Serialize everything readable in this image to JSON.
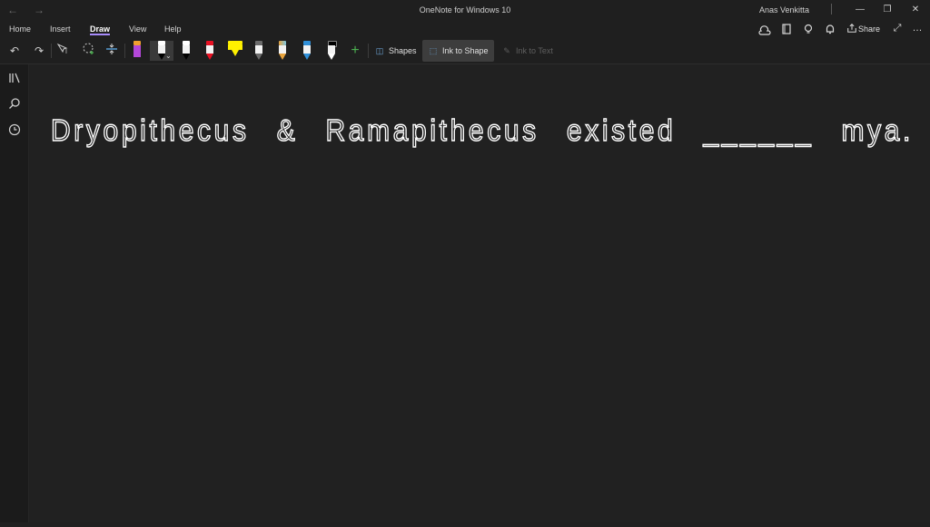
{
  "titlebar": {
    "back_glyph": "←",
    "forward_glyph": "→",
    "title": "OneNote for Windows 10",
    "user": "Anas Venkitta",
    "minimize_glyph": "—",
    "restore_glyph": "❐",
    "close_glyph": "✕"
  },
  "menu": {
    "tabs": [
      "Home",
      "Insert",
      "Draw",
      "View",
      "Help"
    ],
    "active_tab": "Draw",
    "right_icons": [
      "sync-icon",
      "notebook-icon",
      "lightbulb-icon",
      "bell-icon"
    ],
    "share_label": "Share",
    "expand_glyph": "⤢",
    "more_glyph": "…"
  },
  "toolbar": {
    "undo_glyph": "↶",
    "redo_glyph": "↷",
    "pens": [
      {
        "name": "purple-pen",
        "color": "#b347d9",
        "cap": "#f0a030"
      },
      {
        "name": "black-pen-selected",
        "color": "#000000",
        "cap": "#ffffff"
      },
      {
        "name": "black-pen",
        "color": "#000000",
        "cap": "#ffffff"
      },
      {
        "name": "red-pen",
        "color": "#e81123",
        "cap": "#e81123"
      },
      {
        "name": "yellow-highlighter",
        "color": "#fff100",
        "cap": "#fff100"
      },
      {
        "name": "galaxy-pen",
        "color": "#6b6b6b",
        "cap": "#6b6b6b"
      },
      {
        "name": "rainbow-pen",
        "color": "#e8a33c",
        "cap": "#7ec8e3"
      },
      {
        "name": "ocean-pen",
        "color": "#2f8fd8",
        "cap": "#2f8fd8"
      },
      {
        "name": "white-pen",
        "color": "#ffffff",
        "cap": "#000000"
      }
    ],
    "add_pen_glyph": "+",
    "shapes_label": "Shapes",
    "ink_to_shape_label": "Ink to Shape",
    "ink_to_text_label": "Ink to Text"
  },
  "sidebar": {
    "icons": [
      "notebooks-icon",
      "search-icon",
      "recent-icon"
    ]
  },
  "note": {
    "handwriting": "Dryopithecus & Ramapithecus existed ______ mya."
  },
  "colors": {
    "background": "#212121",
    "accent": "#a78bfa",
    "ink": "#ffffff"
  }
}
